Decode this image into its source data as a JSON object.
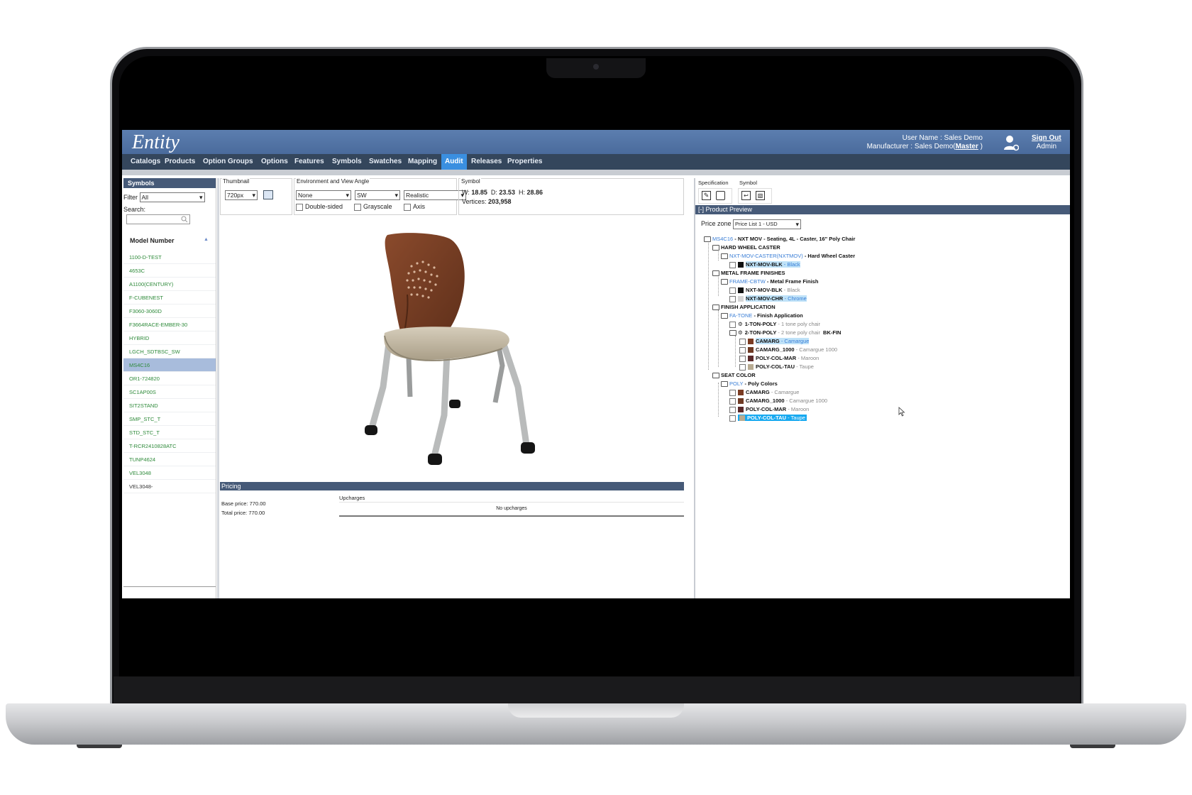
{
  "app": {
    "logo": "Entity",
    "user_line": "User Name : Sales Demo",
    "manufacturer_prefix": "Manufacturer : Sales Demo(",
    "manufacturer_link": "Master",
    "manufacturer_suffix": " )",
    "sign_out": "Sign Out",
    "role": "Admin"
  },
  "nav": {
    "items": [
      "Catalogs",
      "Products",
      "Option Groups",
      "Options",
      "Features",
      "Symbols",
      "Swatches",
      "Mapping",
      "Audit",
      "Releases",
      "Properties"
    ],
    "active": "Audit"
  },
  "left_panel": {
    "title": "Symbols",
    "filter_label": "Filter",
    "filter_value": "All",
    "search_label": "Search:",
    "search_placeholder": "",
    "column_header": "Model Number",
    "sort_icon": "sort-up-icon",
    "items": [
      "1100-D-TEST",
      "4653C",
      "A1100(CENTURY)",
      "F-CUBENEST",
      "F3060-3060D",
      "F3664RACE-EMBER-30",
      "HYBRID",
      "LGCH_SDTBSC_SW",
      "MS4C16",
      "OR1-724820",
      "SC1AP00S",
      "SIT2STAND",
      "SMP_STC_T",
      "STD_STC_T",
      "T-RCR2410828ATC",
      "TUNP4624",
      "VEL3048",
      "VEL3048-"
    ],
    "selected": "MS4C16"
  },
  "toolbar": {
    "thumbnail_label": "Thumbnail",
    "thumbnail_value": "720px",
    "env_label": "Environment and View Angle",
    "env_value": "None",
    "angle_value": "SW",
    "render_value": "Realistic",
    "double_sided": "Double-sided",
    "grayscale": "Grayscale",
    "axis": "Axis",
    "symbol_label": "Symbol",
    "w_label": "W:",
    "w_value": "18.85",
    "d_label": "D:",
    "d_value": "23.53",
    "h_label": "H:",
    "h_value": "28.86",
    "vertices_label": "Vertices:",
    "vertices_value": "203,958"
  },
  "pricing": {
    "title": "Pricing",
    "base_price": "Base price: 770.00",
    "total_price": "Total price: 770.00",
    "upcharges_label": "Upcharges",
    "no_upcharges": "No upcharges"
  },
  "right_panel": {
    "spec_label": "Specification",
    "symbol_label": "Symbol",
    "preview_title": "[-] Product Preview",
    "price_zone_label": "Price zone",
    "price_zone_value": "Price List 1 - USD"
  },
  "tree": {
    "root_code": "MS4C16",
    "root_desc": " - NXT MOV - Seating, 4L - Caster, 16\" Poly Chair",
    "g1": "HARD WHEEL CASTER",
    "g1_opt_code": "NXT-MOV-CASTER(NXTMOV)",
    "g1_opt_desc": " - Hard Wheel Caster",
    "g1_item_code": "NXT-MOV-BLK",
    "g1_item_desc": " - Black",
    "g2": "METAL FRAME FINISHES",
    "g2_opt_code": "FRAME-CBTW",
    "g2_opt_desc": " - Metal Frame Finish",
    "g2_item1_code": "NXT-MOV-BLK",
    "g2_item1_desc": " - Black",
    "g2_item2_code": "NXT-MOV-CHR",
    "g2_item2_desc": " - Chrome",
    "g3": "FINISH APPLICATION",
    "g3_opt_code": "FA-TONE",
    "g3_opt_desc": " - Finish Application",
    "g3_a_code": "1-TON-POLY",
    "g3_a_desc": " - 1 tone poly chair",
    "g3_b_code": "2-TON-POLY",
    "g3_b_desc": " - 2 tone poly chair",
    "g3_b_extra": "BK-FIN",
    "g3_c1_code": "CAMARG",
    "g3_c1_desc": " - Camargue",
    "g3_c2_code": "CAMARG_1000",
    "g3_c2_desc": " - Camargue 1000",
    "g3_c3_code": "POLY-COL-MAR",
    "g3_c3_desc": " - Maroon",
    "g3_c4_code": "POLY-COL-TAU",
    "g3_c4_desc": " - Taupe",
    "g4": "SEAT COLOR",
    "g4_opt_code": "POLY",
    "g4_opt_desc": " - Poly Colors",
    "g4_c1_code": "CAMARG",
    "g4_c1_desc": " - Camargue",
    "g4_c2_code": "CAMARG_1000",
    "g4_c2_desc": " - Camargue 1000",
    "g4_c3_code": "POLY-COL-MAR",
    "g4_c3_desc": " - Maroon",
    "g4_c4_code": "POLY-COL-TAU",
    "g4_c4_desc": " - Taupe"
  },
  "colors": {
    "header_blue": "#4a6b9c",
    "nav_dark": "#34465c",
    "active_tab": "#3a8fe0",
    "list_green": "#2e8a3a",
    "link_blue": "#3a7ed6",
    "camargue": "#7a3b22",
    "maroon": "#5a2a2a",
    "taupe": "#b8ab92",
    "chrome": "#d6d6d6",
    "black": "#111111"
  }
}
